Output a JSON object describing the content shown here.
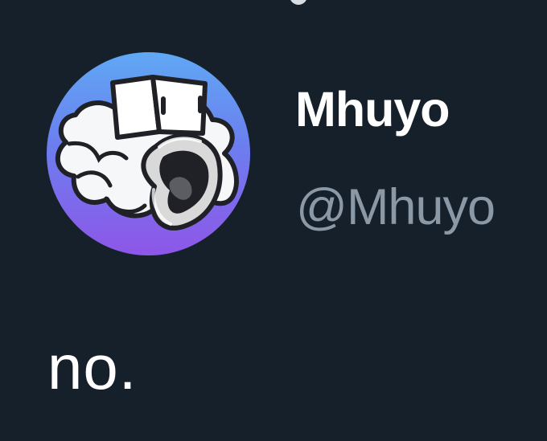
{
  "tweet": {
    "author": {
      "display_name": "Mhuyo",
      "handle": "@Mhuyo",
      "avatar_icon": "white-cloud-creature-avatar-icon"
    },
    "text": "no."
  },
  "colors": {
    "background": "#16202b",
    "primary_text": "#ffffff",
    "secondary_text": "#8b98a5",
    "avatar_gradient_top": "#60a8f4",
    "avatar_gradient_bottom": "#8e56e8"
  }
}
